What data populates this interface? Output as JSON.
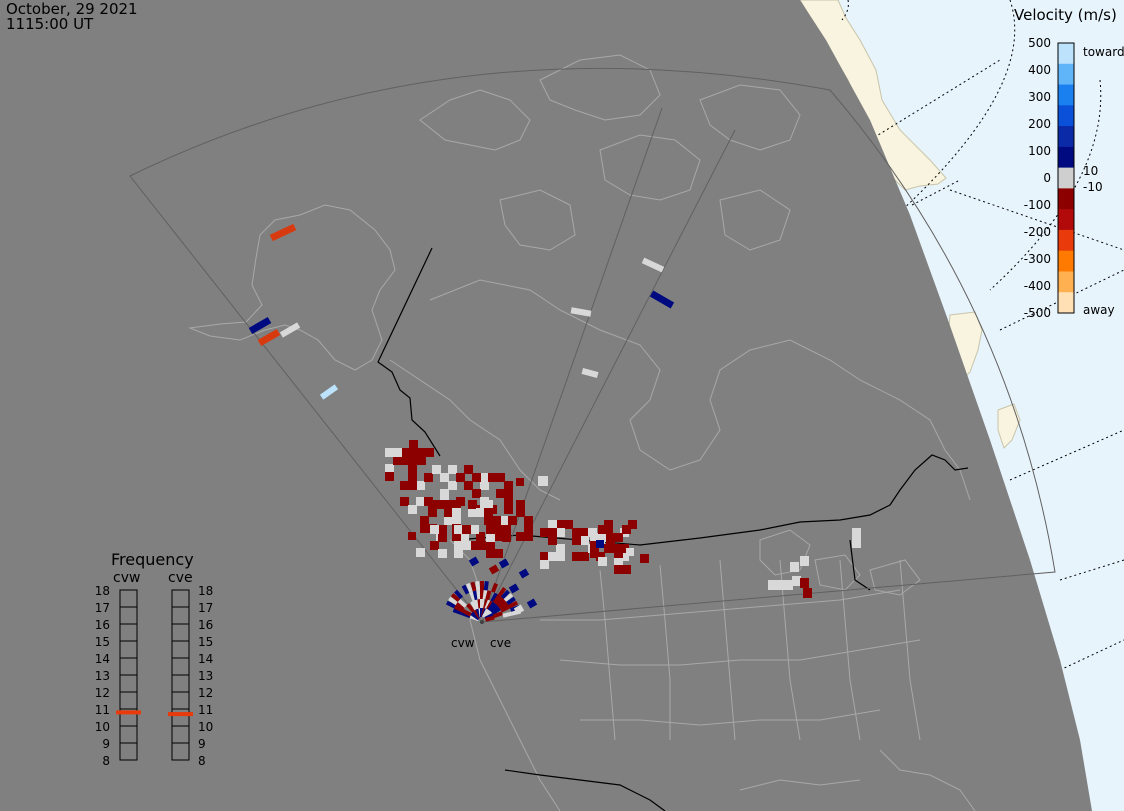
{
  "header": {
    "date": "October, 29 2021",
    "time": "1115:00 UT"
  },
  "velocity_scale": {
    "title": "Velocity (m/s)",
    "ticks": [
      "500",
      "400",
      "300",
      "200",
      "100",
      "0",
      "-100",
      "-200",
      "-300",
      "-400",
      "-500"
    ],
    "side_labels": {
      "toward": "toward",
      "away": "away",
      "pos_threshold": "10",
      "neg_threshold": "-10"
    },
    "colors": [
      "#ffe0b4",
      "#ffb050",
      "#ff7a00",
      "#e83a0a",
      "#b20a0a",
      "#8c0000",
      "#cfcfcf",
      "#000a80",
      "#0a2aa8",
      "#0a50d8",
      "#1a80f0",
      "#60b4f8",
      "#bde3fc"
    ]
  },
  "frequency_panel": {
    "title": "Frequency",
    "radars": [
      "cvw",
      "cve"
    ],
    "levels": [
      "18",
      "17",
      "16",
      "15",
      "14",
      "13",
      "12",
      "11",
      "10",
      "9",
      "8"
    ],
    "active_frequency": {
      "cvw": 10.8,
      "cve": 10.7
    },
    "marker_color": "#e83a0a"
  },
  "radar_sites": [
    {
      "id": "cvw",
      "label": "cvw"
    },
    {
      "id": "cve",
      "label": "cve"
    }
  ],
  "colors": {
    "night_side": "#808080",
    "day_side": "#e8f4fc",
    "land_day": "#f8f4e0",
    "coastline": "#a8a8a8",
    "border": "#000000",
    "fov": "#606060"
  }
}
